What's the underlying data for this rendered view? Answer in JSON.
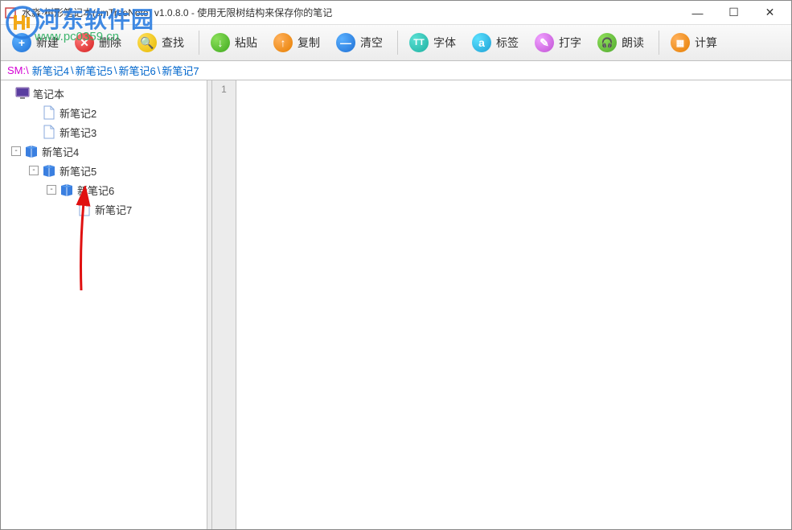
{
  "window": {
    "title": "水淼·树形笔记本(smTreeNote) v1.0.8.0 - 使用无限树结构来保存你的笔记"
  },
  "toolbar": {
    "new": "新建",
    "delete": "删除",
    "search": "查找",
    "paste": "粘贴",
    "copy": "复制",
    "clear": "清空",
    "font": "字体",
    "tag": "标签",
    "type": "打字",
    "read": "朗读",
    "calc": "计算"
  },
  "breadcrumb": {
    "root": "SM:\\",
    "items": [
      "新笔记4",
      "新笔记5",
      "新笔记6",
      "新笔记7"
    ]
  },
  "tree": {
    "root": {
      "label": "笔记本",
      "icon": "monitor",
      "indent": 0,
      "expander": null
    },
    "nodes": [
      {
        "label": "新笔记2",
        "icon": "file",
        "indent": 1,
        "expander": null
      },
      {
        "label": "新笔记3",
        "icon": "file",
        "indent": 1,
        "expander": null
      },
      {
        "label": "新笔记4",
        "icon": "book",
        "indent": 0,
        "expander": "-"
      },
      {
        "label": "新笔记5",
        "icon": "book",
        "indent": 1,
        "expander": "-"
      },
      {
        "label": "新笔记6",
        "icon": "book",
        "indent": 2,
        "expander": "-"
      },
      {
        "label": "新笔记7",
        "icon": "file",
        "indent": 3,
        "expander": null
      }
    ]
  },
  "editor": {
    "line_number": "1",
    "content": ""
  },
  "watermark": {
    "brand": "河东软件园",
    "url": "www.pc0359.cn"
  }
}
